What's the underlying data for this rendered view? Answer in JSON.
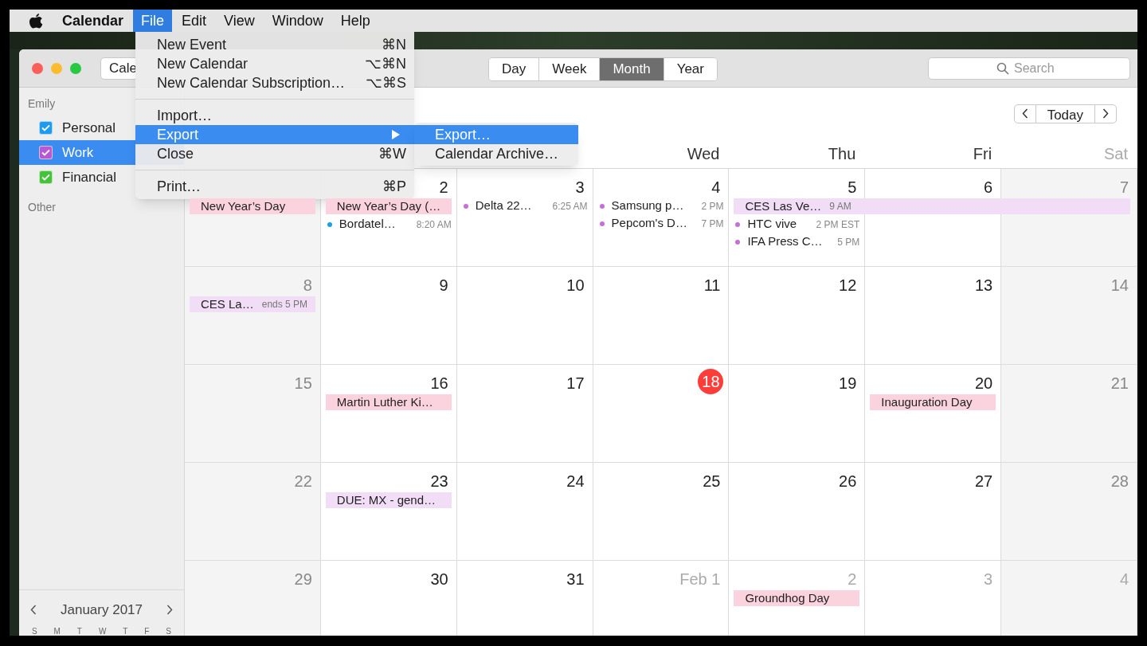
{
  "menubar": {
    "app": "Calendar",
    "menus": [
      {
        "label": "File",
        "selected": true
      },
      {
        "label": "Edit",
        "selected": false
      },
      {
        "label": "View",
        "selected": false
      },
      {
        "label": "Window",
        "selected": false
      },
      {
        "label": "Help",
        "selected": false
      }
    ]
  },
  "file_menu": {
    "sections": [
      [
        {
          "label": "New Event",
          "shortcut": "⌘N",
          "selected": false
        },
        {
          "label": "New Calendar",
          "shortcut": "⌥⌘N",
          "selected": false
        },
        {
          "label": "New Calendar Subscription…",
          "shortcut": "⌥⌘S",
          "selected": false
        }
      ],
      [
        {
          "label": "Import…",
          "selected": false
        },
        {
          "label": "Export",
          "selected": true,
          "submenu": true
        },
        {
          "label": "Close",
          "shortcut": "⌘W",
          "selected": false
        }
      ],
      [
        {
          "label": "Print…",
          "shortcut": "⌘P",
          "selected": false
        }
      ]
    ]
  },
  "export_submenu": [
    {
      "label": "Export…",
      "selected": true
    },
    {
      "label": "Calendar Archive…",
      "selected": false
    }
  ],
  "toolbar": {
    "calendars_button": "Cale",
    "views": [
      {
        "label": "Day",
        "selected": false
      },
      {
        "label": "Week",
        "selected": false
      },
      {
        "label": "Month",
        "selected": true
      },
      {
        "label": "Year",
        "selected": false
      }
    ],
    "search": {
      "placeholder": "Search"
    }
  },
  "sidebar": {
    "groups": [
      {
        "title": "Emily",
        "calendars": [
          {
            "name": "Personal",
            "checked": true,
            "selected": false,
            "color": "#1e9bef"
          },
          {
            "name": "Work",
            "checked": true,
            "selected": true,
            "color": "#b658d8"
          },
          {
            "name": "Financial",
            "checked": true,
            "selected": false,
            "color": "#44c23a"
          }
        ]
      },
      {
        "title": "Other"
      }
    ],
    "mini_calendar": {
      "title": "January 2017",
      "weekdays": [
        "S",
        "M",
        "T",
        "W",
        "T",
        "F",
        "S"
      ]
    }
  },
  "month_nav": {
    "today": "Today"
  },
  "weekdays": [
    "Wed",
    "Thu",
    "Fri",
    "Sat"
  ],
  "weeks": [
    [
      {
        "events": [
          {
            "kind": "allday",
            "title": "New Year’s Day",
            "color": "#fbd3df"
          }
        ]
      },
      {
        "day": "2",
        "other_month": false,
        "today": false,
        "events": [
          {
            "kind": "allday",
            "title": "New Year’s Day (…",
            "color": "#fbd3df"
          },
          {
            "kind": "timed",
            "title": "Bordatel…",
            "time": "8:20 AM",
            "color": "#1ba1e2"
          }
        ]
      },
      {
        "day": "3",
        "other_month": false,
        "today": false,
        "events": [
          {
            "kind": "timed",
            "title": "Delta 22…",
            "time": "6:25 AM",
            "color": "#c56fd8"
          }
        ]
      },
      {
        "day": "4",
        "other_month": false,
        "today": false,
        "events": [
          {
            "kind": "timed",
            "title": "Samsung p…",
            "time": "2 PM",
            "color": "#c56fd8"
          },
          {
            "kind": "timed",
            "title": "Pepcom's D…",
            "time": "7 PM",
            "color": "#c56fd8"
          }
        ]
      },
      {
        "day": "5",
        "other_month": false,
        "today": false,
        "events": [
          {
            "kind": "multiday",
            "title": "CES Las Ve…",
            "time": "9 AM",
            "color": "#f1ddf6"
          },
          {
            "kind": "timed",
            "title": "HTC vive",
            "time": "2 PM EST",
            "color": "#c56fd8"
          },
          {
            "kind": "timed",
            "title": "IFA Press C…",
            "time": "5 PM",
            "color": "#c56fd8"
          }
        ]
      },
      {
        "day": "6",
        "other_month": false,
        "today": false
      },
      {
        "day": "7",
        "other_month": false,
        "today": false
      }
    ],
    [
      {
        "day": "8",
        "other_month": false,
        "today": false,
        "events": [
          {
            "kind": "allday",
            "title": "CES La…",
            "time": "ends 5 PM",
            "color": "#f1ddf6"
          }
        ]
      },
      {
        "day": "9",
        "other_month": false,
        "today": false
      },
      {
        "day": "10",
        "other_month": false,
        "today": false
      },
      {
        "day": "11",
        "other_month": false,
        "today": false
      },
      {
        "day": "12",
        "other_month": false,
        "today": false
      },
      {
        "day": "13",
        "other_month": false,
        "today": false
      },
      {
        "day": "14",
        "other_month": false,
        "today": false
      }
    ],
    [
      {
        "day": "15",
        "other_month": false,
        "today": false
      },
      {
        "day": "16",
        "other_month": false,
        "today": false,
        "events": [
          {
            "kind": "allday",
            "title": "Martin Luther Ki…",
            "color": "#fbd3df"
          }
        ]
      },
      {
        "day": "17",
        "other_month": false,
        "today": false
      },
      {
        "day": "18",
        "other_month": false,
        "today": true
      },
      {
        "day": "19",
        "other_month": false,
        "today": false
      },
      {
        "day": "20",
        "other_month": false,
        "today": false,
        "events": [
          {
            "kind": "allday",
            "title": "Inauguration Day",
            "color": "#fbd3df"
          }
        ]
      },
      {
        "day": "21",
        "other_month": false,
        "today": false
      }
    ],
    [
      {
        "day": "22",
        "other_month": false,
        "today": false
      },
      {
        "day": "23",
        "other_month": false,
        "today": false,
        "events": [
          {
            "kind": "allday",
            "title": "DUE: MX - gend…",
            "color": "#f1ddf6"
          }
        ]
      },
      {
        "day": "24",
        "other_month": false,
        "today": false
      },
      {
        "day": "25",
        "other_month": false,
        "today": false
      },
      {
        "day": "26",
        "other_month": false,
        "today": false
      },
      {
        "day": "27",
        "other_month": false,
        "today": false
      },
      {
        "day": "28",
        "other_month": false,
        "today": false
      }
    ],
    [
      {
        "day": "29",
        "other_month": false,
        "today": false
      },
      {
        "day": "30",
        "other_month": false,
        "today": false
      },
      {
        "day": "31",
        "other_month": false,
        "today": false
      },
      {
        "day": "Feb 1",
        "other_month": true,
        "today": false
      },
      {
        "day": "2",
        "other_month": true,
        "today": false,
        "events": [
          {
            "kind": "allday",
            "title": "Groundhog Day",
            "color": "#fbd3df"
          }
        ]
      },
      {
        "day": "3",
        "other_month": true,
        "today": false
      },
      {
        "day": "4",
        "other_month": true,
        "today": false
      }
    ]
  ]
}
